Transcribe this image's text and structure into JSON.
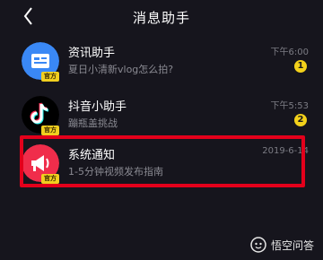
{
  "header": {
    "title": "消息助手"
  },
  "rows": [
    {
      "name": "资讯助手",
      "subtitle": "夏日小清新vlog怎么拍?",
      "time": "下午6:00",
      "unread": "1",
      "badge": "官方",
      "avatar_icon": "news-card-icon",
      "avatar_color": "#3a88f5"
    },
    {
      "name": "抖音小助手",
      "subtitle": "蹦瓶盖挑战",
      "time": "下午5:53",
      "unread": "2",
      "badge": "官方",
      "avatar_icon": "tiktok-note-icon",
      "avatar_color": "#000000"
    },
    {
      "name": "系统通知",
      "subtitle": "1-5分钟视频发布指南",
      "time": "2019-6-14",
      "badge": "官方",
      "avatar_icon": "megaphone-icon",
      "avatar_color": "#f02d4b"
    }
  ],
  "watermark": {
    "text": "悟空问答"
  },
  "colors": {
    "background": "#16151d",
    "highlight": "#e3001b",
    "unread_badge": "#f3d11a"
  }
}
